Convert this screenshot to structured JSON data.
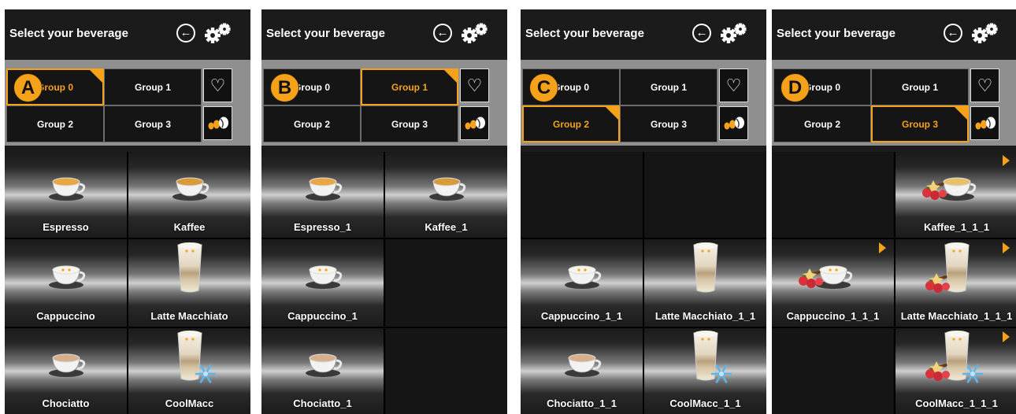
{
  "colors": {
    "accent": "#f5a21a",
    "panel_bg": "#1b1b1b",
    "group_bar": "#8f8f8f"
  },
  "panels": [
    {
      "marker": "A",
      "header": {
        "title": "Select your beverage",
        "back_icon": "back-arrow-icon",
        "settings_icon": "gears-icon"
      },
      "groups": [
        "Group 0",
        "Group 1",
        "Group 2",
        "Group 3"
      ],
      "selected_group": 0,
      "side_icons": [
        "heart-icon",
        "coffee-beans-icon"
      ],
      "beverages": [
        {
          "label": "Espresso",
          "icon": "espresso-cup-icon"
        },
        {
          "label": "Kaffee",
          "icon": "coffee-cup-icon"
        },
        {
          "label": "Cappuccino",
          "icon": "cappuccino-cup-icon"
        },
        {
          "label": "Latte Macchiato",
          "icon": "latte-glass-icon"
        },
        {
          "label": "Chociatto",
          "icon": "chocolate-cup-icon"
        },
        {
          "label": "CoolMacc",
          "icon": "iced-latte-glass-icon"
        }
      ]
    },
    {
      "marker": "B",
      "header": {
        "title": "Select your beverage",
        "back_icon": "back-arrow-icon",
        "settings_icon": "gears-icon"
      },
      "groups": [
        "Group 0",
        "Group 1",
        "Group 2",
        "Group 3"
      ],
      "selected_group": 1,
      "side_icons": [
        "heart-icon",
        "coffee-beans-icon"
      ],
      "beverages": [
        {
          "label": "Espresso_1",
          "icon": "espresso-cup-icon"
        },
        {
          "label": "Kaffee_1",
          "icon": "coffee-cup-icon"
        },
        {
          "label": "Cappuccino_1",
          "icon": "cappuccino-cup-icon"
        },
        null,
        {
          "label": "Chociatto_1",
          "icon": "chocolate-cup-icon"
        },
        null
      ]
    },
    {
      "marker": "C",
      "header": {
        "title": "Select your beverage",
        "back_icon": "back-arrow-icon",
        "settings_icon": "gears-icon"
      },
      "groups": [
        "Group 0",
        "Group 1",
        "Group 2",
        "Group 3"
      ],
      "selected_group": 2,
      "side_icons": [
        "heart-icon",
        "coffee-beans-icon"
      ],
      "beverages": [
        null,
        null,
        {
          "label": "Cappuccino_1_1",
          "icon": "cappuccino-cup-icon"
        },
        {
          "label": "Latte Macchiato_1_1",
          "icon": "latte-glass-icon"
        },
        {
          "label": "Chociatto_1_1",
          "icon": "chocolate-cup-icon"
        },
        {
          "label": "CoolMacc_1_1",
          "icon": "iced-latte-glass-icon"
        }
      ]
    },
    {
      "marker": "D",
      "header": {
        "title": "Select your beverage",
        "back_icon": "back-arrow-icon",
        "settings_icon": "gears-icon"
      },
      "groups": [
        "Group 0",
        "Group 1",
        "Group 2",
        "Group 3"
      ],
      "selected_group": 3,
      "side_icons": [
        "heart-icon",
        "coffee-beans-icon"
      ],
      "beverages": [
        null,
        {
          "label": "Kaffee_1_1_1",
          "icon": "coffee-cup-with-fruit-icon",
          "flag": true
        },
        {
          "label": "Cappuccino_1_1_1",
          "icon": "cappuccino-cup-with-fruit-icon",
          "flag": true
        },
        {
          "label": "Latte Macchiato_1_1_1",
          "icon": "latte-glass-with-fruit-icon",
          "flag": true
        },
        null,
        {
          "label": "CoolMacc_1_1_1",
          "icon": "iced-latte-with-fruit-icon",
          "flag": true
        }
      ]
    }
  ]
}
